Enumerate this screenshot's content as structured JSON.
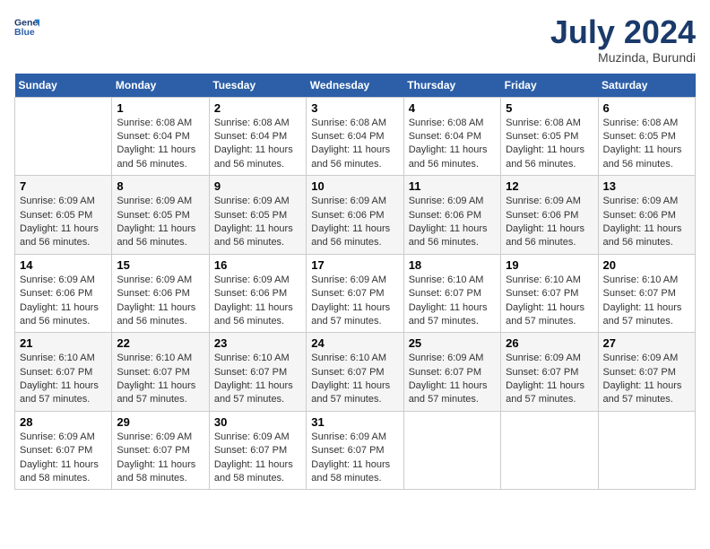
{
  "header": {
    "logo_line1": "General",
    "logo_line2": "Blue",
    "title": "July 2024",
    "subtitle": "Muzinda, Burundi"
  },
  "days_of_week": [
    "Sunday",
    "Monday",
    "Tuesday",
    "Wednesday",
    "Thursday",
    "Friday",
    "Saturday"
  ],
  "weeks": [
    [
      {
        "day": "",
        "info": ""
      },
      {
        "day": "1",
        "info": "Sunrise: 6:08 AM\nSunset: 6:04 PM\nDaylight: 11 hours\nand 56 minutes."
      },
      {
        "day": "2",
        "info": "Sunrise: 6:08 AM\nSunset: 6:04 PM\nDaylight: 11 hours\nand 56 minutes."
      },
      {
        "day": "3",
        "info": "Sunrise: 6:08 AM\nSunset: 6:04 PM\nDaylight: 11 hours\nand 56 minutes."
      },
      {
        "day": "4",
        "info": "Sunrise: 6:08 AM\nSunset: 6:04 PM\nDaylight: 11 hours\nand 56 minutes."
      },
      {
        "day": "5",
        "info": "Sunrise: 6:08 AM\nSunset: 6:05 PM\nDaylight: 11 hours\nand 56 minutes."
      },
      {
        "day": "6",
        "info": "Sunrise: 6:08 AM\nSunset: 6:05 PM\nDaylight: 11 hours\nand 56 minutes."
      }
    ],
    [
      {
        "day": "7",
        "info": "Sunrise: 6:09 AM\nSunset: 6:05 PM\nDaylight: 11 hours\nand 56 minutes."
      },
      {
        "day": "8",
        "info": "Sunrise: 6:09 AM\nSunset: 6:05 PM\nDaylight: 11 hours\nand 56 minutes."
      },
      {
        "day": "9",
        "info": "Sunrise: 6:09 AM\nSunset: 6:05 PM\nDaylight: 11 hours\nand 56 minutes."
      },
      {
        "day": "10",
        "info": "Sunrise: 6:09 AM\nSunset: 6:06 PM\nDaylight: 11 hours\nand 56 minutes."
      },
      {
        "day": "11",
        "info": "Sunrise: 6:09 AM\nSunset: 6:06 PM\nDaylight: 11 hours\nand 56 minutes."
      },
      {
        "day": "12",
        "info": "Sunrise: 6:09 AM\nSunset: 6:06 PM\nDaylight: 11 hours\nand 56 minutes."
      },
      {
        "day": "13",
        "info": "Sunrise: 6:09 AM\nSunset: 6:06 PM\nDaylight: 11 hours\nand 56 minutes."
      }
    ],
    [
      {
        "day": "14",
        "info": "Sunrise: 6:09 AM\nSunset: 6:06 PM\nDaylight: 11 hours\nand 56 minutes."
      },
      {
        "day": "15",
        "info": "Sunrise: 6:09 AM\nSunset: 6:06 PM\nDaylight: 11 hours\nand 56 minutes."
      },
      {
        "day": "16",
        "info": "Sunrise: 6:09 AM\nSunset: 6:06 PM\nDaylight: 11 hours\nand 56 minutes."
      },
      {
        "day": "17",
        "info": "Sunrise: 6:09 AM\nSunset: 6:07 PM\nDaylight: 11 hours\nand 57 minutes."
      },
      {
        "day": "18",
        "info": "Sunrise: 6:10 AM\nSunset: 6:07 PM\nDaylight: 11 hours\nand 57 minutes."
      },
      {
        "day": "19",
        "info": "Sunrise: 6:10 AM\nSunset: 6:07 PM\nDaylight: 11 hours\nand 57 minutes."
      },
      {
        "day": "20",
        "info": "Sunrise: 6:10 AM\nSunset: 6:07 PM\nDaylight: 11 hours\nand 57 minutes."
      }
    ],
    [
      {
        "day": "21",
        "info": "Sunrise: 6:10 AM\nSunset: 6:07 PM\nDaylight: 11 hours\nand 57 minutes."
      },
      {
        "day": "22",
        "info": "Sunrise: 6:10 AM\nSunset: 6:07 PM\nDaylight: 11 hours\nand 57 minutes."
      },
      {
        "day": "23",
        "info": "Sunrise: 6:10 AM\nSunset: 6:07 PM\nDaylight: 11 hours\nand 57 minutes."
      },
      {
        "day": "24",
        "info": "Sunrise: 6:10 AM\nSunset: 6:07 PM\nDaylight: 11 hours\nand 57 minutes."
      },
      {
        "day": "25",
        "info": "Sunrise: 6:09 AM\nSunset: 6:07 PM\nDaylight: 11 hours\nand 57 minutes."
      },
      {
        "day": "26",
        "info": "Sunrise: 6:09 AM\nSunset: 6:07 PM\nDaylight: 11 hours\nand 57 minutes."
      },
      {
        "day": "27",
        "info": "Sunrise: 6:09 AM\nSunset: 6:07 PM\nDaylight: 11 hours\nand 57 minutes."
      }
    ],
    [
      {
        "day": "28",
        "info": "Sunrise: 6:09 AM\nSunset: 6:07 PM\nDaylight: 11 hours\nand 58 minutes."
      },
      {
        "day": "29",
        "info": "Sunrise: 6:09 AM\nSunset: 6:07 PM\nDaylight: 11 hours\nand 58 minutes."
      },
      {
        "day": "30",
        "info": "Sunrise: 6:09 AM\nSunset: 6:07 PM\nDaylight: 11 hours\nand 58 minutes."
      },
      {
        "day": "31",
        "info": "Sunrise: 6:09 AM\nSunset: 6:07 PM\nDaylight: 11 hours\nand 58 minutes."
      },
      {
        "day": "",
        "info": ""
      },
      {
        "day": "",
        "info": ""
      },
      {
        "day": "",
        "info": ""
      }
    ]
  ]
}
